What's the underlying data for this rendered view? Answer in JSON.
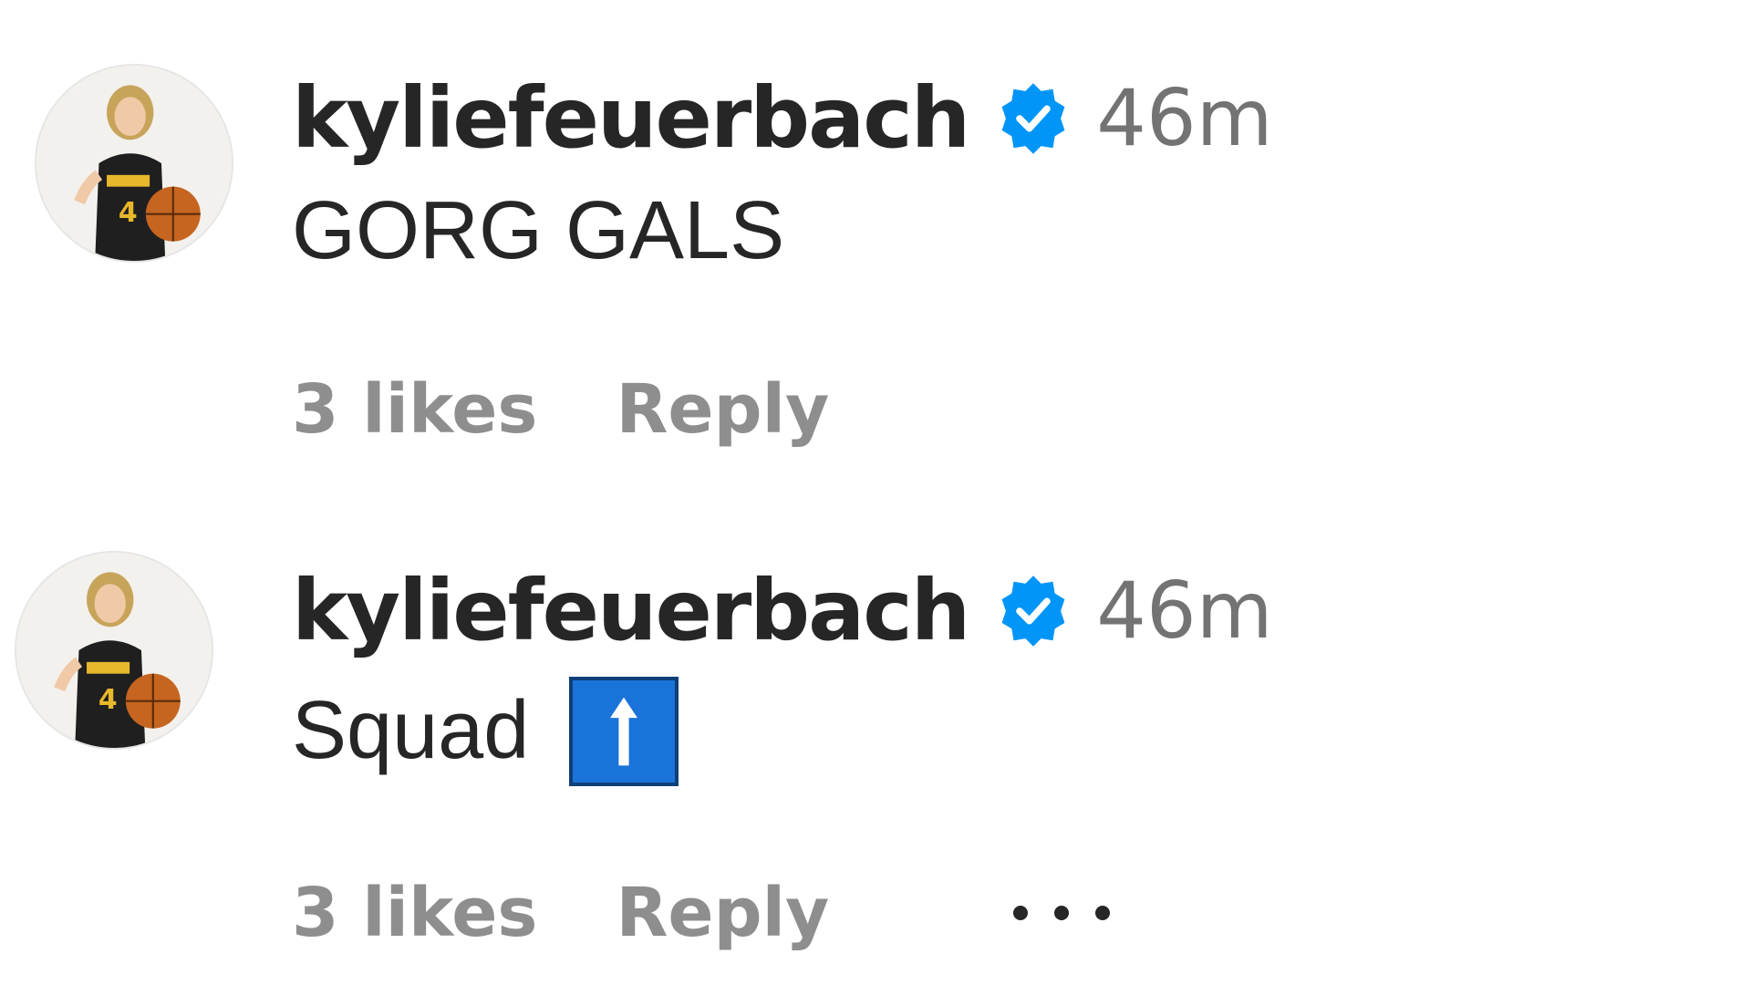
{
  "comments": [
    {
      "username": "kyliefeuerbach",
      "timestamp": "46m",
      "text": "GORG GALS",
      "likes": "3 likes",
      "reply_label": "Reply",
      "verified_icon": "verified-badge-icon",
      "avatar_icon": "avatar-photo"
    },
    {
      "username": "kyliefeuerbach",
      "timestamp": "46m",
      "text": "Squad",
      "emoji": "up-arrow-emoji",
      "likes": "3 likes",
      "reply_label": "Reply",
      "more_icon": "more-options-icon",
      "verified_icon": "verified-badge-icon",
      "avatar_icon": "avatar-photo"
    }
  ],
  "colors": {
    "verified_blue": "#0095f6",
    "username": "#262626",
    "muted": "#8e8e8e",
    "timestamp": "#737373",
    "emoji_blue": "#1a73d8"
  }
}
